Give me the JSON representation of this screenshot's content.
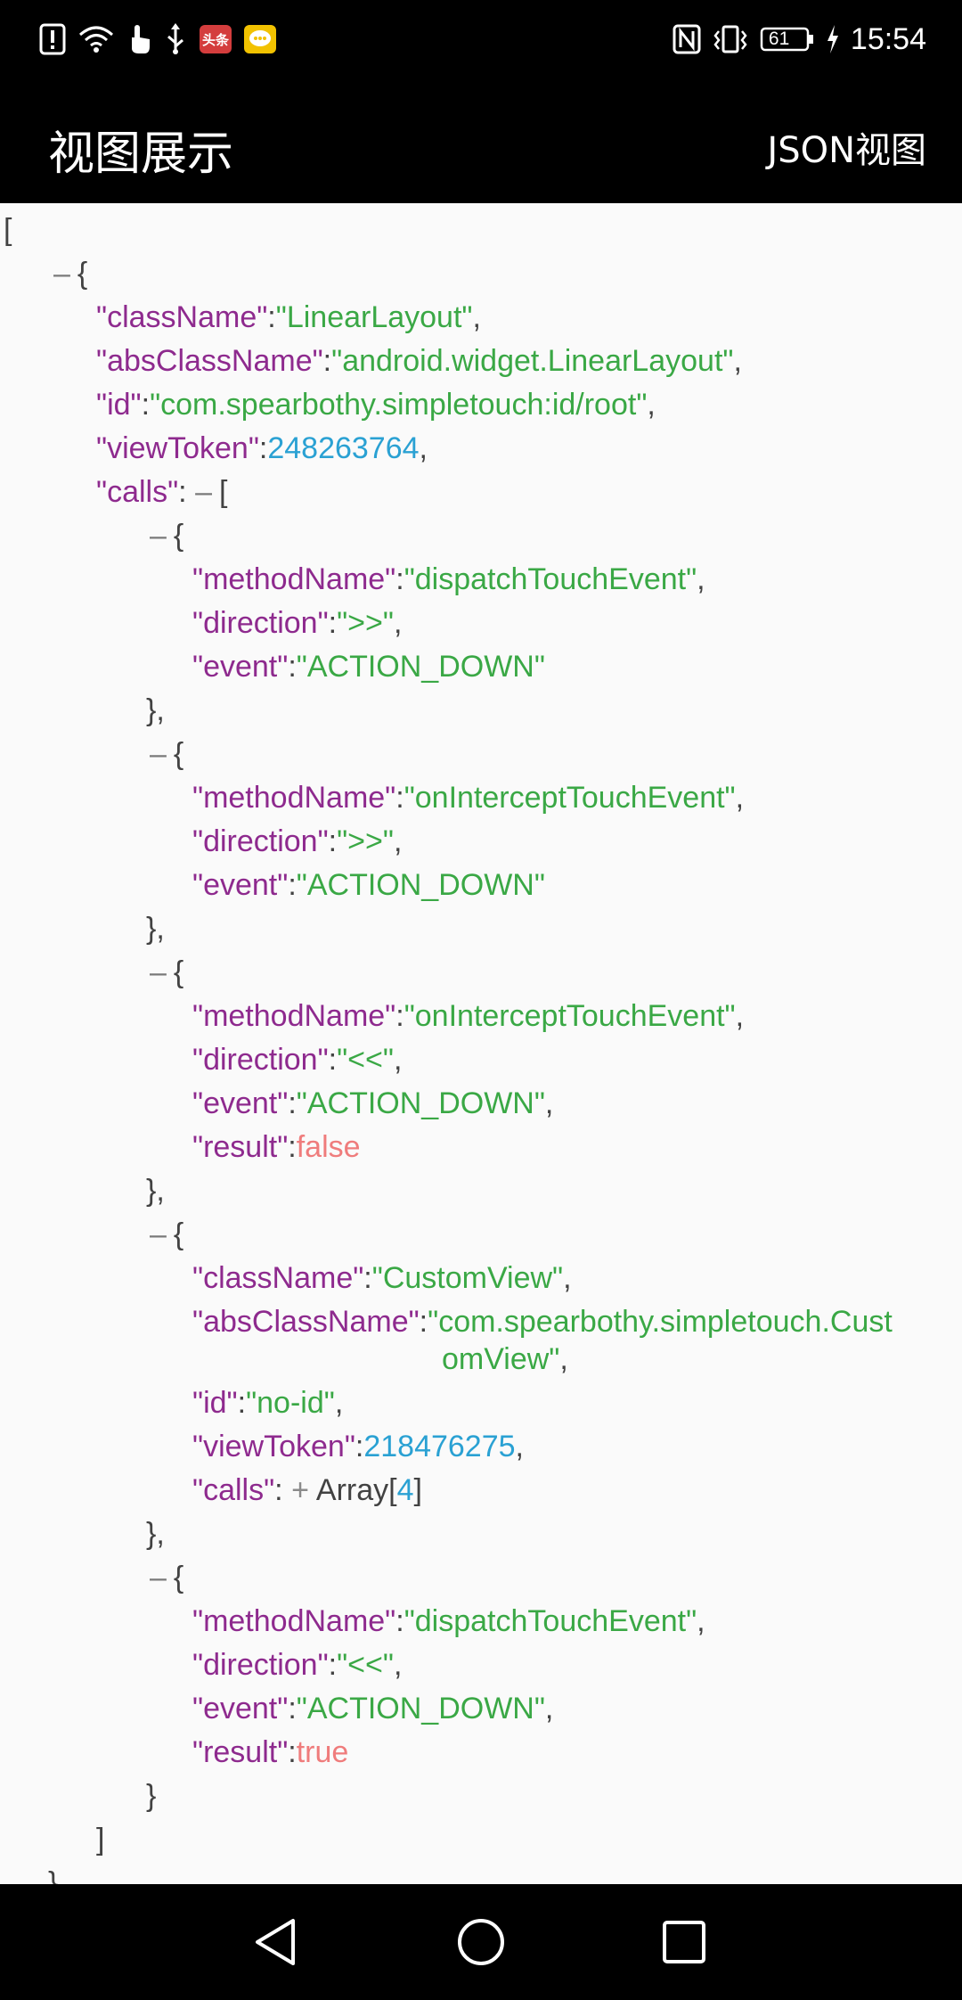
{
  "status_bar": {
    "time": "15:54",
    "battery": "61",
    "badge_toutiao": "头条"
  },
  "app_bar": {
    "title": "视图展示",
    "action": "JSON视图"
  },
  "json": {
    "open_array": "[",
    "item1_open": "{",
    "l1": {
      "key": "\"className\"",
      "value": "\"LinearLayout\""
    },
    "l2": {
      "key": "\"absClassName\"",
      "value": "\"android.widget.LinearLayout\""
    },
    "l3": {
      "key": "\"id\"",
      "value": "\"com.spearbothy.simpletouch:id/root\""
    },
    "l4": {
      "key": "\"viewToken\"",
      "value": "248263764"
    },
    "l5": {
      "key": "\"calls\"",
      "value": "["
    },
    "c1": {
      "methodName": "\"dispatchTouchEvent\"",
      "direction": "\">>\"",
      "event": "\"ACTION_DOWN\""
    },
    "c2": {
      "methodName": "\"onInterceptTouchEvent\"",
      "direction": "\">>\"",
      "event": "\"ACTION_DOWN\""
    },
    "c3": {
      "methodName": "\"onInterceptTouchEvent\"",
      "direction": "\"<<\"",
      "event": "\"ACTION_DOWN\"",
      "result": "false"
    },
    "c4": {
      "className": "\"CustomView\"",
      "absClassName_line1": "\"com.spearbothy.simpletouch.Cust",
      "absClassName_line2": "omView\"",
      "id": "\"no-id\"",
      "viewToken": "218476275",
      "calls_label": "Array[",
      "calls_count": "4",
      "calls_close": "]"
    },
    "c5": {
      "methodName": "\"dispatchTouchEvent\"",
      "direction": "\"<<\"",
      "event": "\"ACTION_DOWN\"",
      "result": "true"
    },
    "keys": {
      "methodName": "\"methodName\"",
      "direction": "\"direction\"",
      "event": "\"event\"",
      "result": "\"result\"",
      "className": "\"className\"",
      "absClassName": "\"absClassName\"",
      "id": "\"id\"",
      "viewToken": "\"viewToken\"",
      "calls": "\"calls\""
    },
    "collapse_symbol": "–",
    "expand_symbol": "+"
  },
  "colors": {
    "key": "#8e2a8e",
    "string": "#3aa845",
    "number": "#2aa1d3",
    "boolean": "#ef7c7c",
    "punct": "#424242"
  }
}
